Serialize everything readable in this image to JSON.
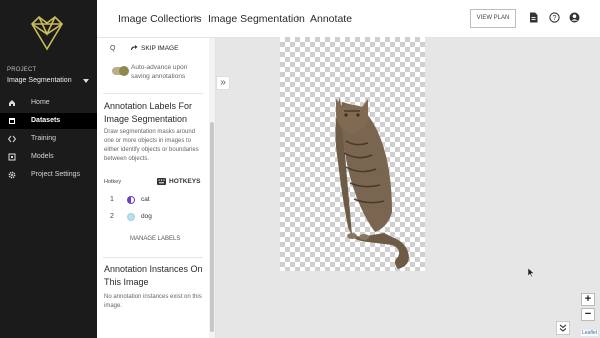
{
  "sidebar": {
    "project_label": "PROJECT",
    "project_name": "Image Segmentation",
    "nav": [
      {
        "label": "Home",
        "icon": "home-icon",
        "active": false
      },
      {
        "label": "Datasets",
        "icon": "datasets-icon",
        "active": true
      },
      {
        "label": "Training",
        "icon": "code-icon",
        "active": false
      },
      {
        "label": "Models",
        "icon": "models-icon",
        "active": false
      },
      {
        "label": "Project Settings",
        "icon": "gear-icon",
        "active": false
      }
    ]
  },
  "breadcrumb": {
    "items": [
      "Image Collections",
      "Image Segmentation",
      "Annotate"
    ],
    "separator": "›"
  },
  "header": {
    "view_plan": "VIEW PLAN",
    "icons": [
      "document-icon",
      "help-icon",
      "account-icon"
    ]
  },
  "panel": {
    "skip_hotkey": "Q",
    "skip_label": "SKIP IMAGE",
    "auto_advance": "Auto-advance upon saving annotations",
    "auto_advance_on": true,
    "labels_title": "Annotation Labels For Image Segmentation",
    "labels_desc": "Draw segmentation masks around one or more objects in images to either identify objects or boundaries between objects.",
    "hotkey_header": "Hotkey",
    "hotkeys_label": "HOTKEYS",
    "labels": [
      {
        "num": "1",
        "name": "cat",
        "color": "#6a3fbf"
      },
      {
        "num": "2",
        "name": "dog",
        "color": "#b6e0ef"
      }
    ],
    "manage_labels": "MANAGE LABELS",
    "instances_title": "Annotation Instances On This Image",
    "instances_empty": "No annotation instances exist on this image."
  },
  "canvas": {
    "expand_icon": "»",
    "zoom_in": "+",
    "zoom_out": "−",
    "scroll_down_icon": "chevron-double-down-icon",
    "attribution": "Leaflet"
  },
  "colors": {
    "sidebar_bg": "#1b1b1b",
    "toggle_on": "#8e8950",
    "canvas_bg": "#e6e6e6"
  }
}
